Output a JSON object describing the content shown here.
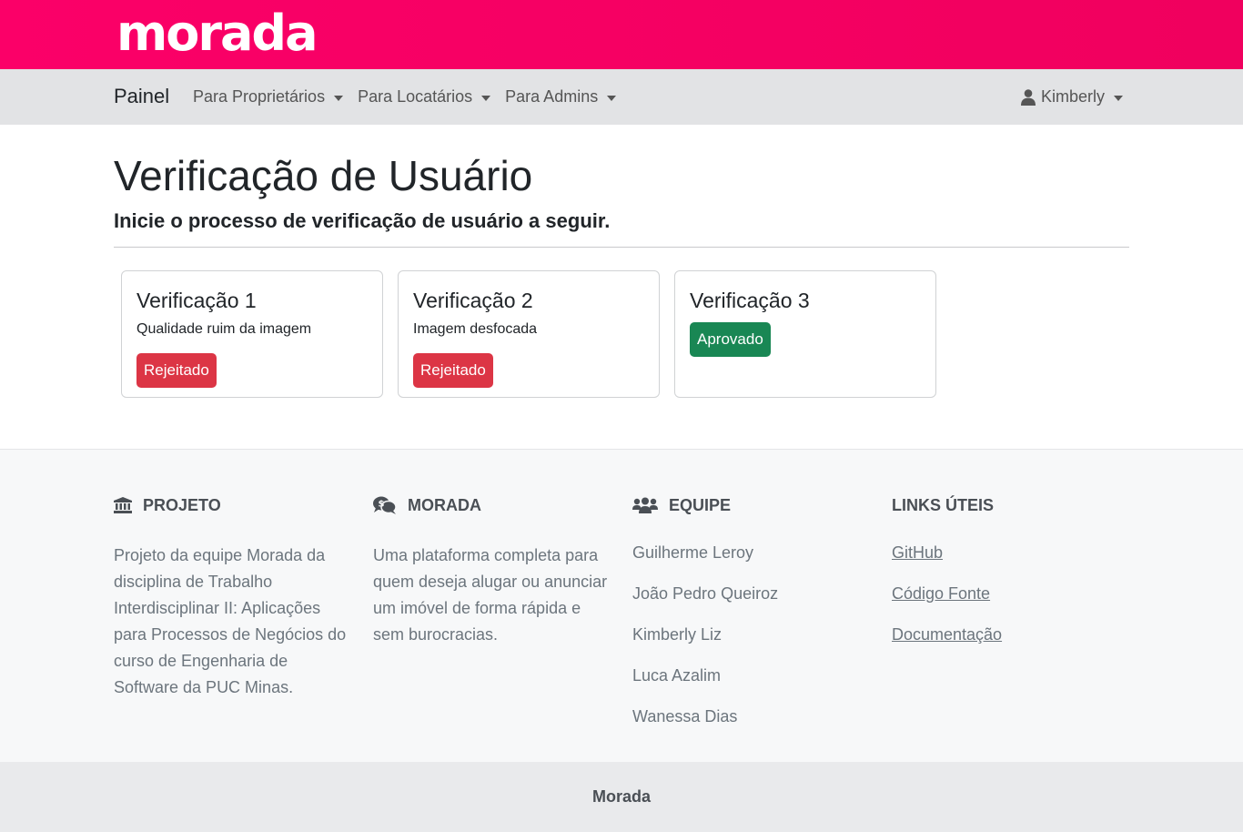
{
  "brand": {
    "logo_text": "morada",
    "color": "#fb0068"
  },
  "nav": {
    "home": "Painel",
    "menus": [
      {
        "label": "Para Proprietários"
      },
      {
        "label": "Para Locatários"
      },
      {
        "label": "Para Admins"
      }
    ],
    "user": {
      "label": "Kimberly",
      "icon": "user-icon"
    }
  },
  "page": {
    "title": "Verificação de Usuário",
    "subtitle": "Inicie o processo de verificação de usuário a seguir."
  },
  "verifications": [
    {
      "title": "Verificação 1",
      "reason": "Qualidade ruim da imagem",
      "status": "Rejeitado",
      "status_color": "#dc3545"
    },
    {
      "title": "Verificação 2",
      "reason": "Imagem desfocada",
      "status": "Rejeitado",
      "status_color": "#dc3545"
    },
    {
      "title": "Verificação 3",
      "reason": "",
      "status": "Aprovado",
      "status_color": "#198754"
    }
  ],
  "footer": {
    "projeto": {
      "heading": "PROJETO",
      "icon": "landmark-icon",
      "text": "Projeto da equipe Morada da disciplina de Trabalho Interdisciplinar II: Aplicações para Processos de Negócios do curso de Engenharia de Software da PUC Minas."
    },
    "morada": {
      "heading": "MORADA",
      "icon": "comments-dollar-icon",
      "text": "Uma plataforma completa para quem deseja alugar ou anunciar um imóvel de forma rápida e sem burocracias."
    },
    "equipe": {
      "heading": "EQUIPE",
      "icon": "users-icon",
      "members": [
        "Guilherme Leroy",
        "João Pedro Queiroz",
        "Kimberly Liz",
        "Luca Azalim",
        "Wanessa Dias"
      ]
    },
    "links": {
      "heading": "LINKS ÚTEIS",
      "items": [
        "GitHub",
        "Código Fonte",
        "Documentação"
      ]
    },
    "bottom": "Morada"
  }
}
